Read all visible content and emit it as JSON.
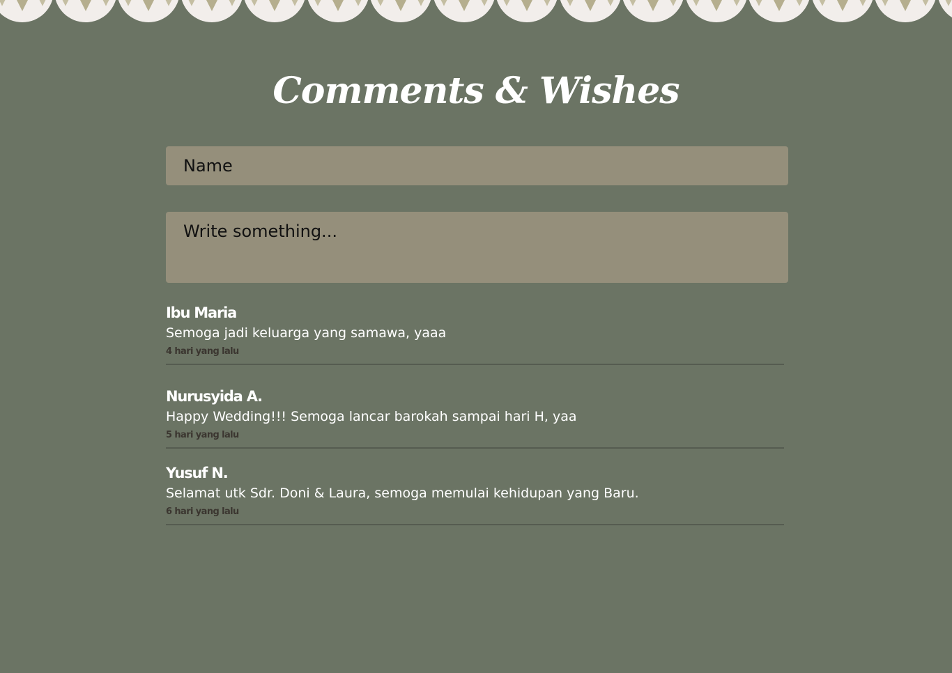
{
  "title": "Comments & Wishes",
  "form": {
    "name_placeholder": "Name",
    "message_placeholder": "Write something..."
  },
  "comments": [
    {
      "name": "Ibu Maria",
      "text": "Semoga jadi keluarga yang samawa, yaaa",
      "time": "4 hari yang lalu"
    },
    {
      "name": "Nurusyida A.",
      "text": "Happy Wedding!!! Semoga lancar barokah sampai hari H, yaa",
      "time": "5 hari yang lalu"
    },
    {
      "name": "Yusuf N.",
      "text": "Selamat utk Sdr. Doni & Laura, semoga memulai kehidupan yang Baru.",
      "time": "6 hari yang lalu"
    }
  ],
  "colors": {
    "background": "#6b7464",
    "input": "#958f7b",
    "scallop": "#f2eeeb"
  }
}
